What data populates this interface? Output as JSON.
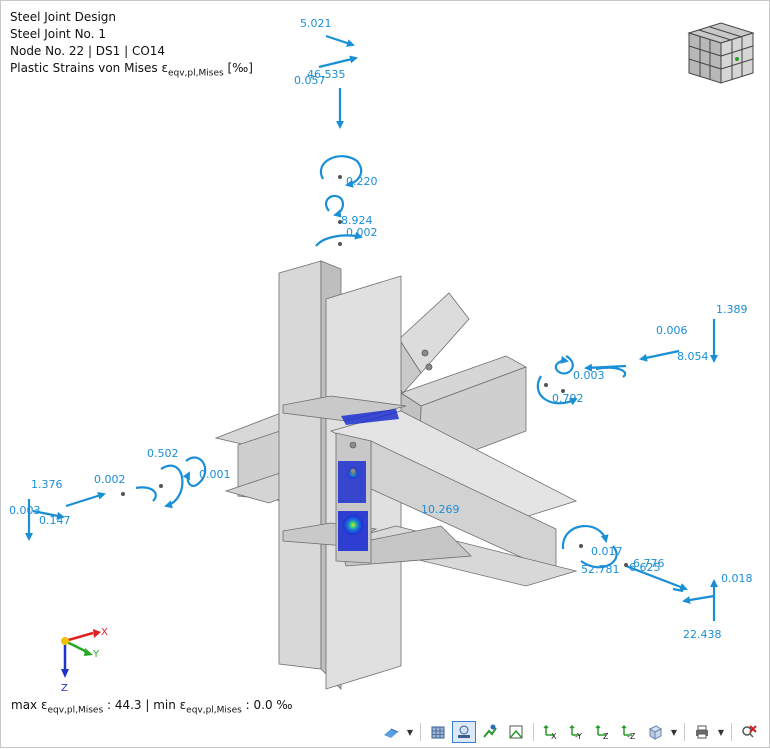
{
  "info": {
    "line1": "Steel Joint Design",
    "line2": "Steel Joint No. 1",
    "line3": "Node No. 22 | DS1 | CO14",
    "line4_prefix": "Plastic Strains von Mises ε",
    "line4_sub": "eqv,pl,Mises",
    "line4_suffix": " [‰]"
  },
  "footer": {
    "max_prefix": "max ε",
    "max_sub": "eqv,pl,Mises",
    "max_value": " : 44.3 | min ε",
    "min_sub": "eqv,pl,Mises",
    "min_value": " : 0.0 ‰"
  },
  "labels": {
    "top_5021": "5.021",
    "top_46535": "46.535",
    "top_0057": "0.057",
    "top_0220": "0.220",
    "top_8924": "8.924",
    "top_0002": "0.002",
    "right_1389": "1.389",
    "right_0006": "0.006",
    "right_8054": "8.054",
    "right_0003": "0.003",
    "right_0792": "0.792",
    "left_1376": "1.376",
    "left_0002": "0.002",
    "left_0502": "0.502",
    "left_0001": "0.001",
    "left_0003": "0.003",
    "left_0147": "0.147",
    "center_10269": "10.269",
    "br_0017": "0.017",
    "br_6776": "6.776",
    "br_52781": "52.781",
    "br_6625": "6.625",
    "br_0018": "0.018",
    "br_22438": "22.438"
  },
  "axes": {
    "x": "X",
    "y": "Y",
    "z": "Z"
  },
  "toolbar": {
    "items": [
      "views-icon",
      "display-icon",
      "active-view-icon",
      "render-icon",
      "perspective-icon",
      "view-x-icon",
      "view-minus-y-icon",
      "view-z-icon",
      "view-minus-z-icon",
      "iso-view-icon",
      "print-icon",
      "close-results-icon"
    ],
    "x_label": "X",
    "minus_y_label": "-Y",
    "z_label": "Z",
    "minus_z_label": "-Z"
  },
  "colors": {
    "accent": "#1a8fd6",
    "steel": "#d9d9d9",
    "steel_dark": "#bdbdbd",
    "hot": "#1c2fd0"
  }
}
